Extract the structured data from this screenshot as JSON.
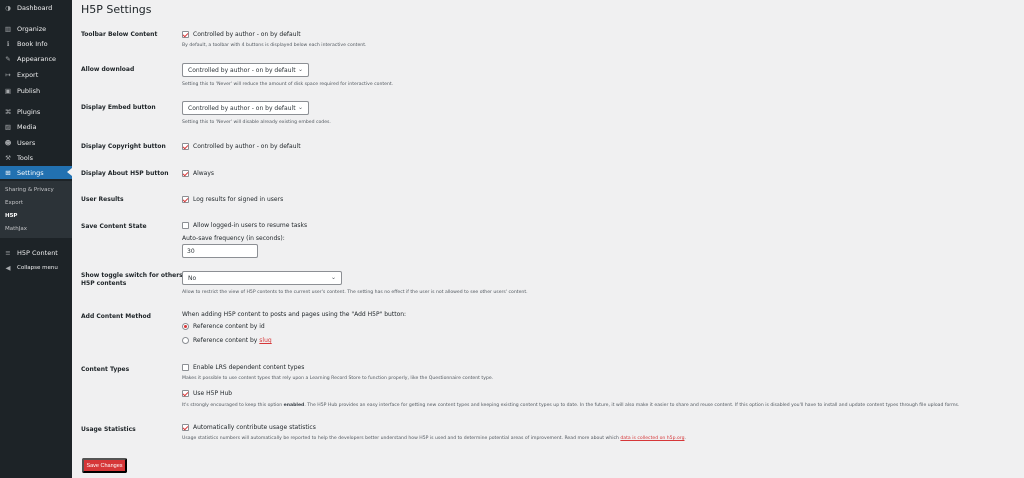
{
  "sidebar": {
    "items": [
      {
        "label": "Dashboard",
        "icon": "dashboard-icon",
        "glyph": "◑"
      },
      {
        "label": "Organize",
        "icon": "book-icon",
        "glyph": "▥"
      },
      {
        "label": "Book Info",
        "icon": "info-icon",
        "glyph": "ℹ"
      },
      {
        "label": "Appearance",
        "icon": "paintbrush-icon",
        "glyph": "✎"
      },
      {
        "label": "Export",
        "icon": "export-icon",
        "glyph": "↦"
      },
      {
        "label": "Publish",
        "icon": "publish-icon",
        "glyph": "▣"
      },
      {
        "label": "Plugins",
        "icon": "plugin-icon",
        "glyph": "⌘"
      },
      {
        "label": "Media",
        "icon": "media-icon",
        "glyph": "▨"
      },
      {
        "label": "Users",
        "icon": "users-icon",
        "glyph": "☻"
      },
      {
        "label": "Tools",
        "icon": "wrench-icon",
        "glyph": "⚒"
      },
      {
        "label": "Settings",
        "icon": "settings-icon",
        "glyph": "⊞"
      },
      {
        "label": "H5P Content",
        "icon": "h5p-icon",
        "glyph": "≡"
      },
      {
        "label": "Collapse menu",
        "icon": "collapse-icon",
        "glyph": "◀"
      }
    ],
    "submenu": [
      "Sharing & Privacy",
      "Export",
      "H5P",
      "MathJax"
    ]
  },
  "page": {
    "title": "H5P Settings"
  },
  "settings": {
    "toolbar": {
      "label": "Toolbar Below Content",
      "checkbox": "Controlled by author - on by default",
      "desc": "By default, a toolbar with 4 buttons is displayed below each interactive content."
    },
    "download": {
      "label": "Allow download",
      "value": "Controlled by author - on by default",
      "desc": "Setting this to 'Never' will reduce the amount of disk space required for interactive content."
    },
    "embed": {
      "label": "Display Embed button",
      "value": "Controlled by author - on by default",
      "desc": "Setting this to 'Never' will disable already existing embed codes."
    },
    "copyright": {
      "label": "Display Copyright button",
      "checkbox": "Controlled by author - on by default"
    },
    "about": {
      "label": "Display About H5P button",
      "checkbox": "Always"
    },
    "results": {
      "label": "User Results",
      "checkbox": "Log results for signed in users"
    },
    "state": {
      "label": "Save Content State",
      "checkbox": "Allow logged-in users to resume tasks",
      "freq_label": "Auto-save frequency (in seconds):",
      "freq_value": "30"
    },
    "toggle": {
      "label_1": "Show toggle switch for others'",
      "label_2": "H5P contents",
      "value": "No",
      "desc": "Allow to restrict the view of H5P contents to the current user's content. The setting has no effect if the user is not allowed to see other users' content."
    },
    "method": {
      "label": "Add Content Method",
      "intro": "When adding H5P content to posts and pages using the \"Add H5P\" button:",
      "radio_id": "Reference content by id",
      "radio_slug_prefix": "Reference content by",
      "radio_slug_link": "slug"
    },
    "types": {
      "label": "Content Types",
      "lrs_checkbox": "Enable LRS dependent content types",
      "lrs_desc": "Makes it possible to use content types that rely upon a Learning Record Store to function properly, like the Questionnaire content type.",
      "hub_checkbox": "Use H5P Hub",
      "hub_desc_1": "It's strongly encouraged to keep this option",
      "hub_desc_bold": "enabled",
      "hub_desc_2": ". The H5P Hub provides an easy interface for getting new content types and keeping existing content types up to date. In the future, it will also make it easier to share and reuse content. If this option is disabled you'll have to install and update content types through file upload forms."
    },
    "usage": {
      "label": "Usage Statistics",
      "checkbox": "Automatically contribute usage statistics",
      "desc": "Usage statistics numbers will automatically be reported to help the developers better understand how H5P is used and to determine potential areas of improvement. Read more about which",
      "link": "data is collected on h5p.org",
      "desc_end": "."
    }
  },
  "save_button": "Save Changes",
  "colors": {
    "accent": "#d63638",
    "sidebar_bg": "#1d2327",
    "current_bg": "#2271b1"
  }
}
